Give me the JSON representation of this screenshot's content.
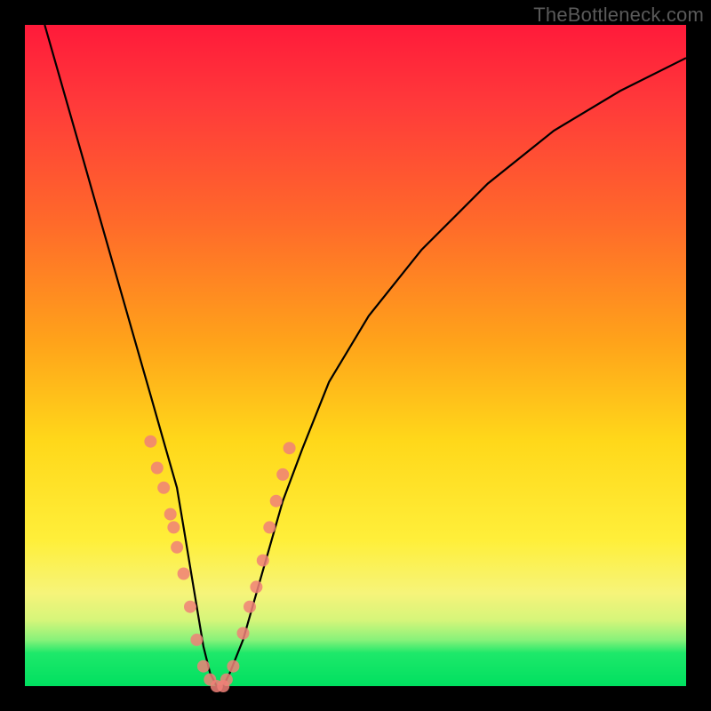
{
  "watermark": "TheBottleneck.com",
  "colors": {
    "frame": "#000000",
    "curve": "#000000",
    "marker": "#f08078",
    "gradient_top": "#ff1a3a",
    "gradient_bottom": "#00e060"
  },
  "chart_data": {
    "type": "line",
    "title": "",
    "xlabel": "",
    "ylabel": "",
    "xlim": [
      0,
      100
    ],
    "ylim": [
      0,
      100
    ],
    "series": [
      {
        "name": "bottleneck-curve",
        "x": [
          3,
          5,
          7,
          9,
          11,
          13,
          15,
          17,
          19,
          21,
          23,
          24,
          25,
          26,
          27,
          28,
          29,
          30,
          31,
          33,
          35,
          37,
          39,
          42,
          46,
          52,
          60,
          70,
          80,
          90,
          100
        ],
        "y": [
          100,
          93,
          86,
          79,
          72,
          65,
          58,
          51,
          44,
          37,
          30,
          24,
          18,
          12,
          6,
          2,
          0,
          0,
          2,
          7,
          14,
          21,
          28,
          36,
          46,
          56,
          66,
          76,
          84,
          90,
          95
        ]
      }
    ],
    "markers": [
      {
        "x": 19,
        "y": 37
      },
      {
        "x": 20,
        "y": 33
      },
      {
        "x": 21,
        "y": 30
      },
      {
        "x": 22,
        "y": 26
      },
      {
        "x": 22.5,
        "y": 24
      },
      {
        "x": 23,
        "y": 21
      },
      {
        "x": 24,
        "y": 17
      },
      {
        "x": 25,
        "y": 12
      },
      {
        "x": 26,
        "y": 7
      },
      {
        "x": 27,
        "y": 3
      },
      {
        "x": 28,
        "y": 1
      },
      {
        "x": 29,
        "y": 0
      },
      {
        "x": 30,
        "y": 0
      },
      {
        "x": 30.5,
        "y": 1
      },
      {
        "x": 31.5,
        "y": 3
      },
      {
        "x": 33,
        "y": 8
      },
      {
        "x": 34,
        "y": 12
      },
      {
        "x": 35,
        "y": 15
      },
      {
        "x": 36,
        "y": 19
      },
      {
        "x": 37,
        "y": 24
      },
      {
        "x": 38,
        "y": 28
      },
      {
        "x": 39,
        "y": 32
      },
      {
        "x": 40,
        "y": 36
      }
    ]
  }
}
